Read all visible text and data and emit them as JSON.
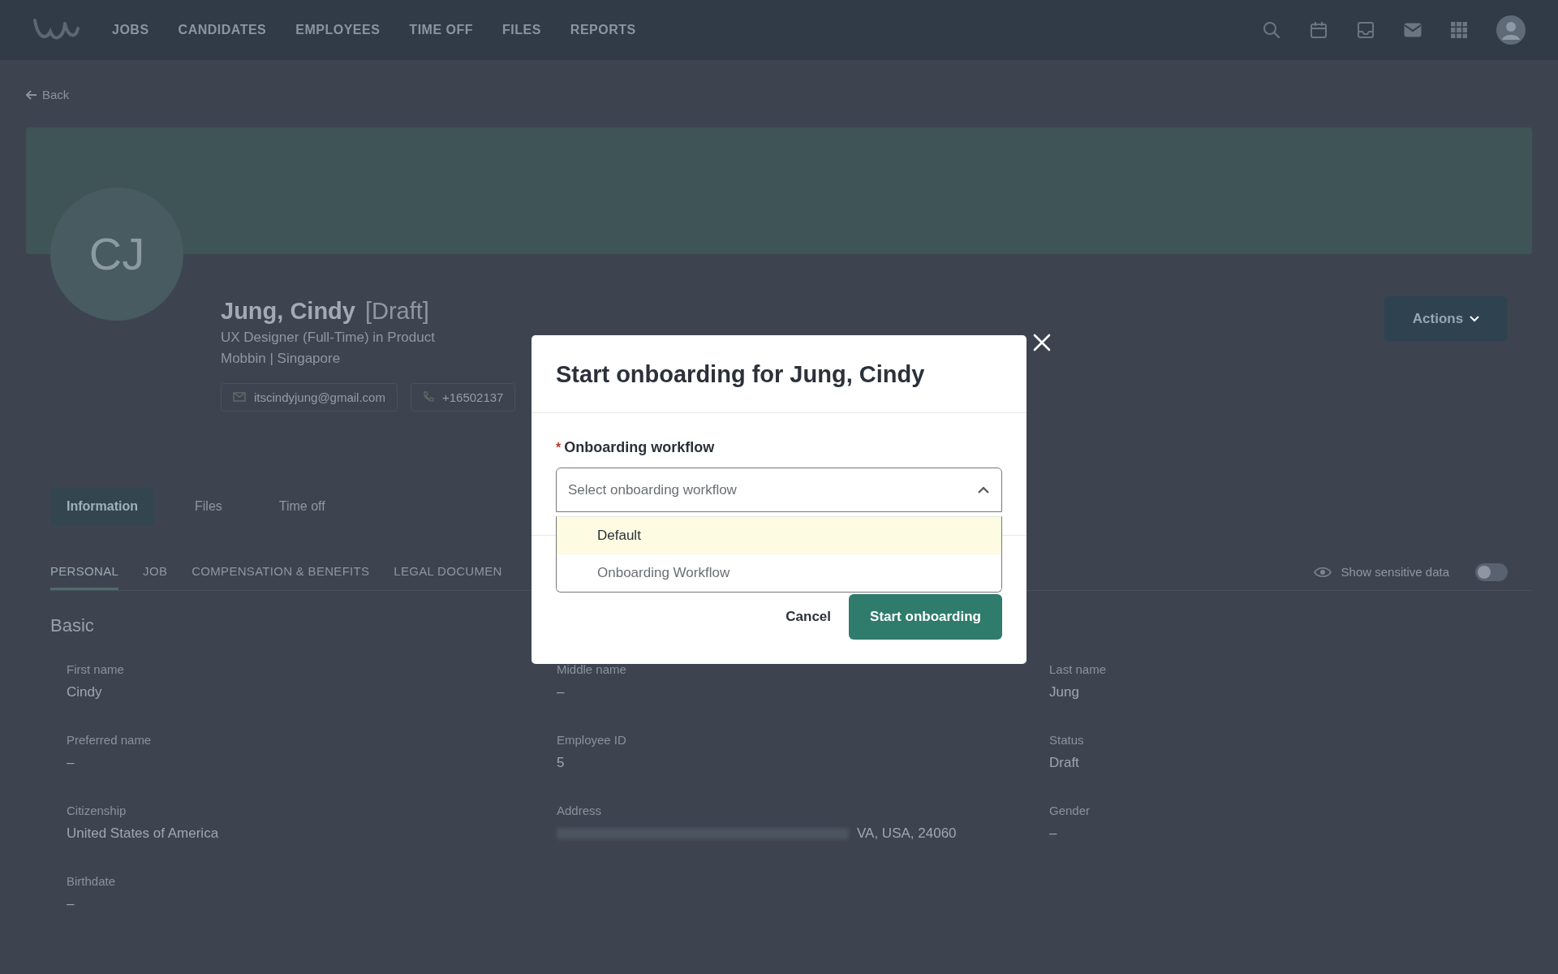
{
  "nav": {
    "items": [
      {
        "label": "JOBS"
      },
      {
        "label": "CANDIDATES"
      },
      {
        "label": "EMPLOYEES"
      },
      {
        "label": "TIME OFF"
      },
      {
        "label": "FILES"
      },
      {
        "label": "REPORTS"
      }
    ]
  },
  "back": "Back",
  "profile": {
    "initials": "CJ",
    "name": "Jung, Cindy",
    "status": "[Draft]",
    "title": "UX Designer (Full-Time) in Product",
    "location": "Mobbin | Singapore",
    "email": "itscindyjung@gmail.com",
    "phone": "+16502137"
  },
  "actions_button": "Actions",
  "tabs": [
    {
      "label": "Information",
      "selected": true
    },
    {
      "label": "Files",
      "selected": false
    },
    {
      "label": "Time off",
      "selected": false
    }
  ],
  "subtabs": [
    {
      "label": "PERSONAL",
      "selected": true
    },
    {
      "label": "JOB",
      "selected": false
    },
    {
      "label": "COMPENSATION & BENEFITS",
      "selected": false
    },
    {
      "label": "LEGAL DOCUMEN",
      "selected": false
    }
  ],
  "sensitive": {
    "label": "Show sensitive data",
    "on": false
  },
  "section": {
    "title": "Basic",
    "fields": [
      {
        "label": "First name",
        "value": "Cindy",
        "kind": "plain"
      },
      {
        "label": "Middle name",
        "value": "–",
        "kind": "plain"
      },
      {
        "label": "Last name",
        "value": "Jung",
        "kind": "plain"
      },
      {
        "label": "Preferred name",
        "value": "–",
        "kind": "plain"
      },
      {
        "label": "Employee ID",
        "value": "5",
        "kind": "plain"
      },
      {
        "label": "Status",
        "value": "Draft",
        "kind": "plain"
      },
      {
        "label": "Citizenship",
        "value": "United States of America",
        "kind": "plain"
      },
      {
        "label": "Address",
        "value": "VA, USA, 24060",
        "kind": "masked"
      },
      {
        "label": "Gender",
        "value": "–",
        "kind": "plain"
      },
      {
        "label": "Birthdate",
        "value": "–",
        "kind": "plain"
      }
    ]
  },
  "modal": {
    "title": "Start onboarding for Jung, Cindy",
    "field_label": "Onboarding workflow",
    "required_mark": "*",
    "placeholder": "Select onboarding workflow",
    "expanded": true,
    "options": [
      {
        "label": "Default",
        "selected": true
      },
      {
        "label": "Onboarding Workflow",
        "selected": false
      }
    ],
    "cancel": "Cancel",
    "submit": "Start onboarding"
  }
}
